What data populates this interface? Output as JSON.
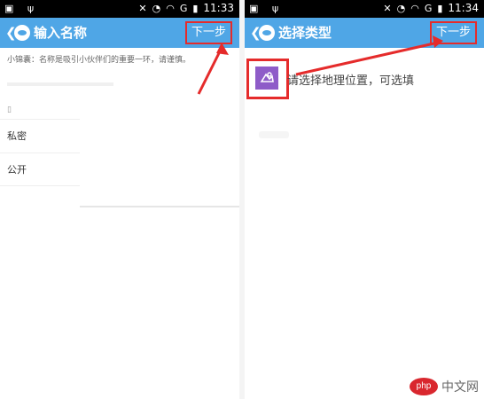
{
  "left": {
    "status": {
      "time": "11:33",
      "signal": "G"
    },
    "header": {
      "back": "❮",
      "title": "输入名称",
      "next": "下一步"
    },
    "hint": "小锦囊：名称是吸引小伙伴们的重要一环，请谨慎。",
    "mark": "▯",
    "options": [
      "私密",
      "公开"
    ]
  },
  "right": {
    "status": {
      "time": "11:34",
      "signal": "G"
    },
    "header": {
      "back": "❮",
      "title": "选择类型",
      "next": "下一步"
    },
    "geo_text": "请选择地理位置，可选填"
  },
  "watermark": {
    "badge": "php",
    "site": "中文网"
  },
  "colors": {
    "appbar": "#4fa6e6",
    "highlight": "#e52b2b",
    "geo_icon": "#8e5cc8"
  }
}
